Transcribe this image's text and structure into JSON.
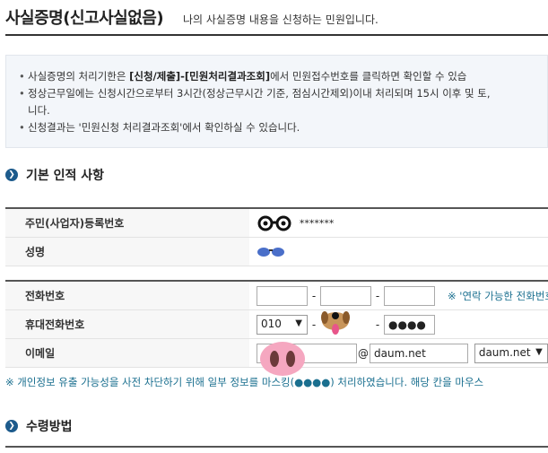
{
  "header": {
    "title": "사실증명(신고사실없음)",
    "subtitle": "나의 사실증명 내용을 신청하는 민원입니다."
  },
  "notice": {
    "line1_pre": "사실증명의 처리기한은 ",
    "line1_bold": "[신청/제출]-[민원처리결과조회]",
    "line1_post": "에서 민원접수번호를 클릭하면 확인할 수 있습",
    "line2": "정상근무일에는 신청시간으로부터 3시간(정상근무시간 기준, 점심시간제외)이내 처리되며 15시 이후 및 토,",
    "line2_cont": "니다.",
    "line3": "신청결과는 '민원신청 처리결과조회'에서 확인하실 수 있습니다."
  },
  "section_basic": {
    "title": "기본 인적 사항",
    "rrn_label": "주민(사업자)등록번호",
    "rrn_value": "*******",
    "name_label": "성명"
  },
  "contact": {
    "phone_label": "전화번호",
    "phone_note": "※ '연락 가능한 전화번호",
    "mobile_label": "휴대전화번호",
    "mobile_prefix": "010",
    "mobile_last": "●●●●",
    "email_label": "이메일",
    "email_at": "@",
    "email_domain": "daum.net",
    "email_domain_select": "daum.net",
    "separator": "-"
  },
  "privacy_note": "※ 개인정보 유출 가능성을 사전 차단하기 위해 일부 정보를 마스킹(●●●●) 처리하였습니다. 해당 칸을 마우스",
  "section_receive": {
    "title": "수령방법"
  },
  "colors": {
    "accent": "#1d5b8c",
    "note": "#1a6f8f"
  }
}
